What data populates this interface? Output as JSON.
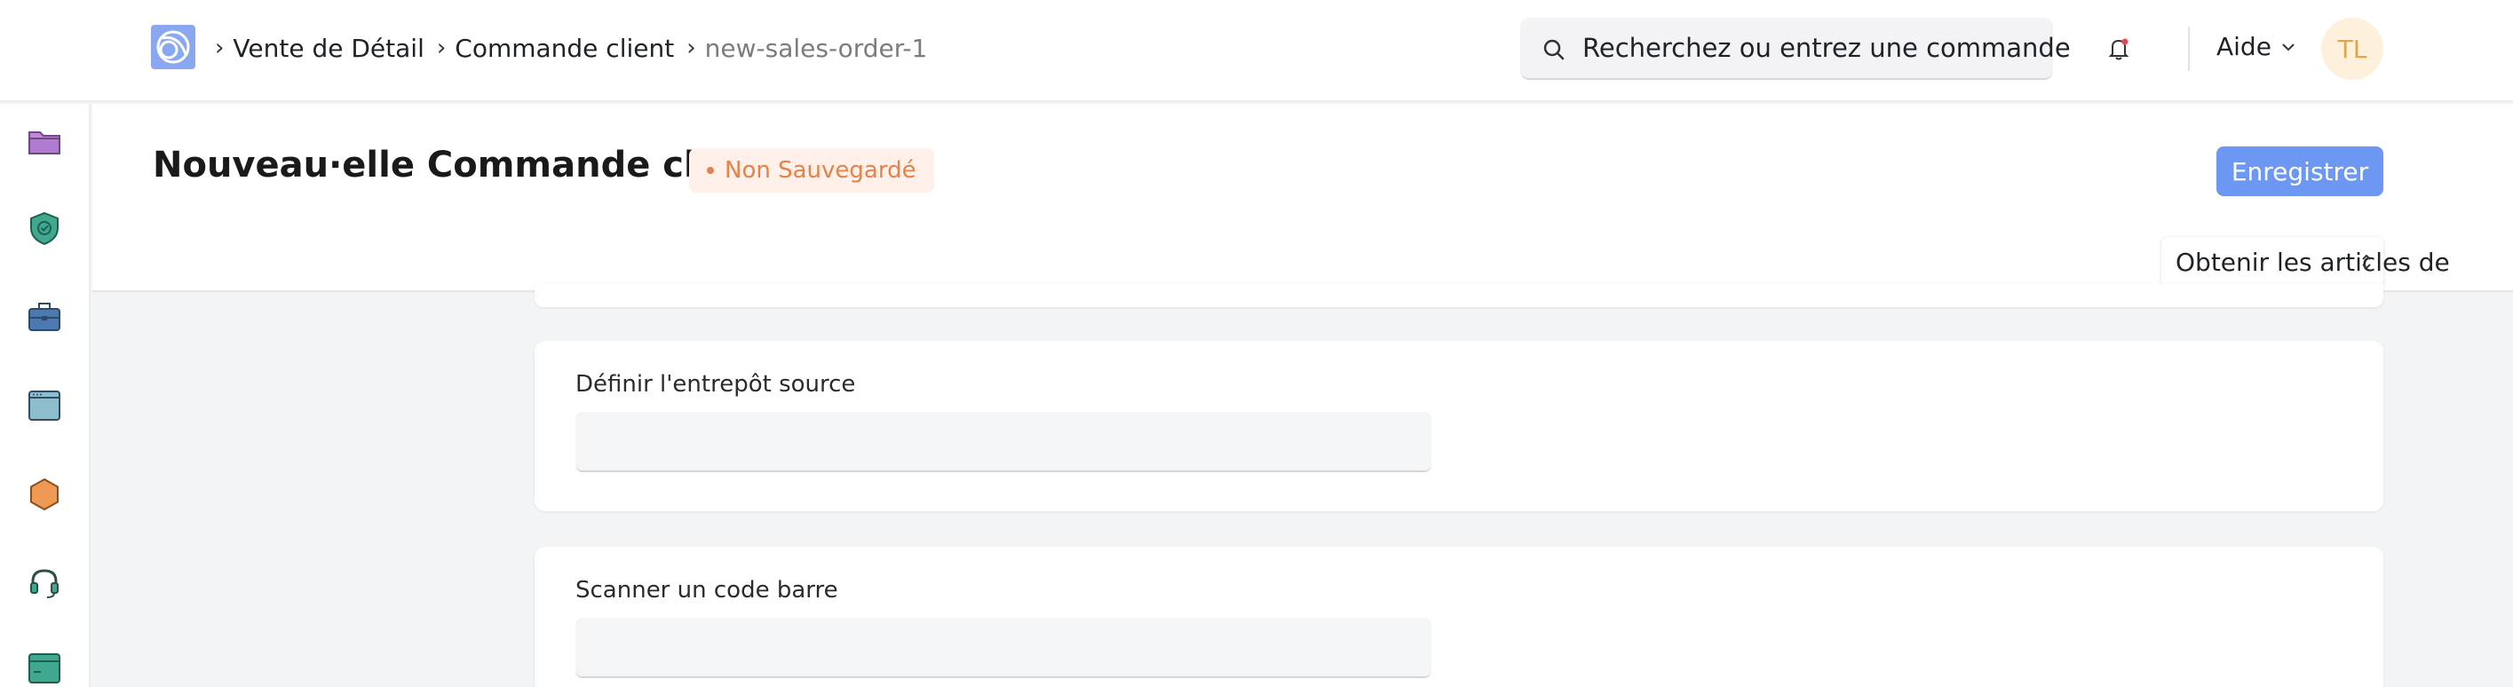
{
  "breadcrumb": {
    "items": [
      {
        "label": "Vente de Détail"
      },
      {
        "label": "Commande client"
      },
      {
        "label": "new-sales-order-1"
      }
    ]
  },
  "search": {
    "placeholder": "Recherchez ou entrez une commande"
  },
  "header": {
    "help_label": "Aide",
    "avatar_initials": "TL"
  },
  "sidebar": {
    "icons": [
      "folder-icon",
      "shield-check-icon",
      "briefcase-icon",
      "window-icon",
      "hexagon-icon",
      "headset-icon",
      "terminal-window-icon"
    ]
  },
  "page": {
    "title": "Nouveau·elle Commande client",
    "status": "Non Sauvegardé",
    "save_label": "Enregistrer",
    "get_items_label": "Obtenir les articles de"
  },
  "form": {
    "source_warehouse": {
      "label": "Définir l'entrepôt source",
      "value": ""
    },
    "scan_barcode": {
      "label": "Scanner un code barre",
      "value": ""
    }
  },
  "colors": {
    "accent": "#6c97f3",
    "status": "#e5814a",
    "avatar_text": "#e4a54a"
  }
}
